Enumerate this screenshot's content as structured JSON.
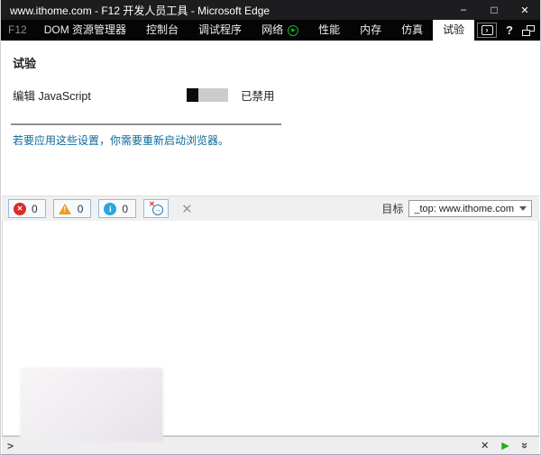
{
  "window": {
    "title": "www.ithome.com - F12 开发人员工具 - Microsoft Edge"
  },
  "window_controls": {
    "minimize": "–",
    "maximize": "□",
    "close": "✕"
  },
  "tab_bar": {
    "tabs": [
      {
        "label": "F12"
      },
      {
        "label": "DOM 资源管理器"
      },
      {
        "label": "控制台"
      },
      {
        "label": "调试程序"
      },
      {
        "label": "网络"
      },
      {
        "label": "性能"
      },
      {
        "label": "内存"
      },
      {
        "label": "仿真"
      },
      {
        "label": "试验"
      }
    ],
    "selected_tab": "试验",
    "help_label": "?"
  },
  "experiments": {
    "title": "试验",
    "setting_label": "编辑 JavaScript",
    "toggle_state": "已禁用",
    "restart_notice": "若要应用这些设置，你需要重新启动浏览器。"
  },
  "console_toolbar": {
    "error_count": "0",
    "warning_count": "0",
    "info_count": "0",
    "target_label": "目标",
    "target_value": "_top: www.ithome.com"
  },
  "console_input": {
    "prompt": ">"
  },
  "glyphs": {
    "error_x": "✕",
    "warning_bang": "!",
    "info_i": "i",
    "nav_arrow": "→",
    "nav_x": "✕",
    "clear": "✕",
    "net_record": "▶",
    "console_box": "›",
    "input_clear": "✕",
    "input_run": "▶",
    "input_expand": "»"
  },
  "colors": {
    "error_red": "#dc2a2a",
    "warning_orange": "#ef9c23",
    "info_blue": "#2aa6df",
    "record_green": "#1db31d",
    "run_green": "#1faf1f",
    "notice_blue": "#0c6a9c",
    "counter_border_blue": "#92bcdd"
  }
}
